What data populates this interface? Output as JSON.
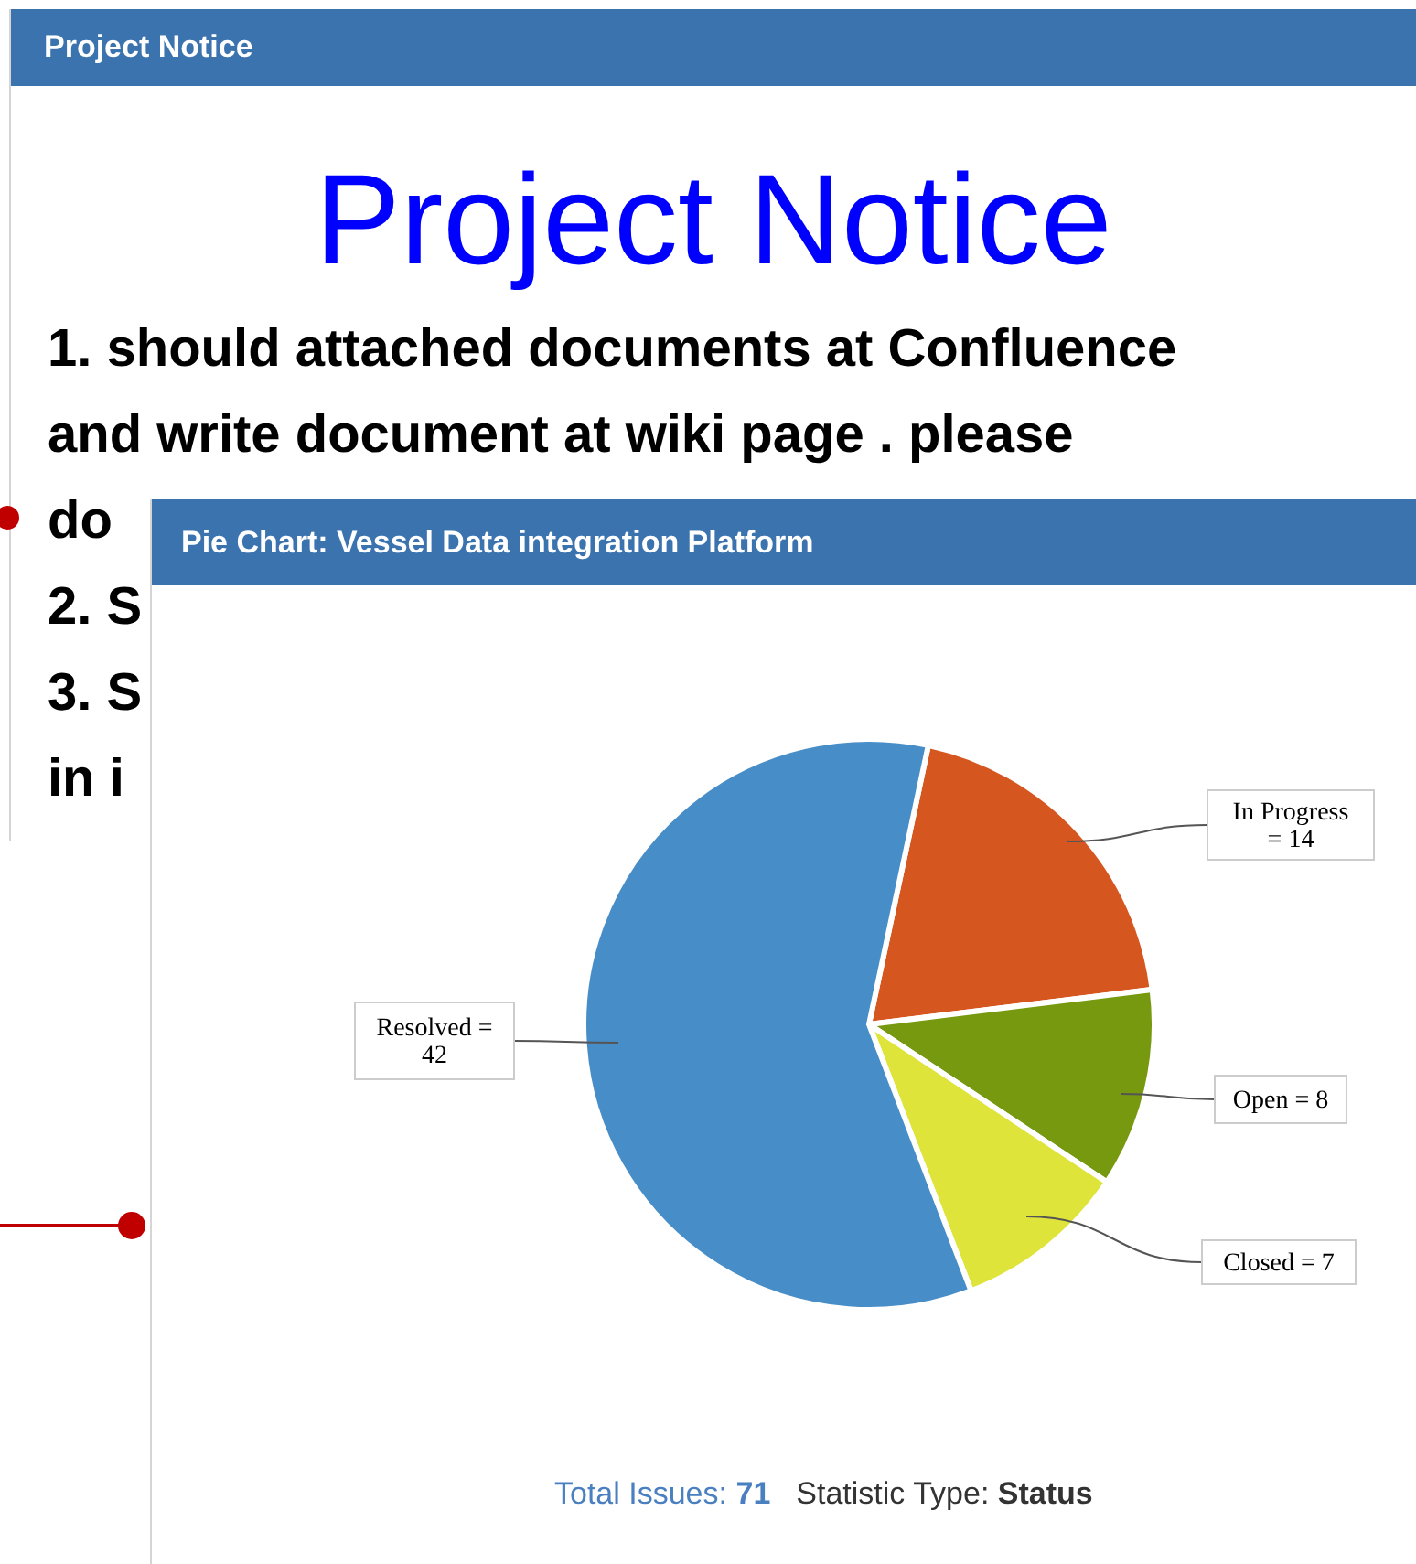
{
  "notice_panel": {
    "title": "Project Notice",
    "heading": "Project Notice",
    "lines": [
      "1. should attached documents at Confluence",
      "and write document at wiki page . please",
      "do",
      "2. S",
      "3. S",
      "in i"
    ]
  },
  "chart_panel": {
    "title": "Pie Chart: Vessel Data integration Platform",
    "chart_data": {
      "type": "pie",
      "categories": [
        "In Progress",
        "Open",
        "Closed",
        "Resolved"
      ],
      "values": [
        14,
        8,
        7,
        42
      ],
      "colors": [
        "#d65620",
        "#76990f",
        "#dfe43a",
        "#478dc7"
      ],
      "value_labels": [
        "= 14",
        "= 8",
        "= 7",
        "=\n42"
      ]
    },
    "footer": {
      "total_label": "Total Issues:",
      "total_value": "71",
      "type_label": "Statistic Type:",
      "type_value": "Status"
    }
  }
}
